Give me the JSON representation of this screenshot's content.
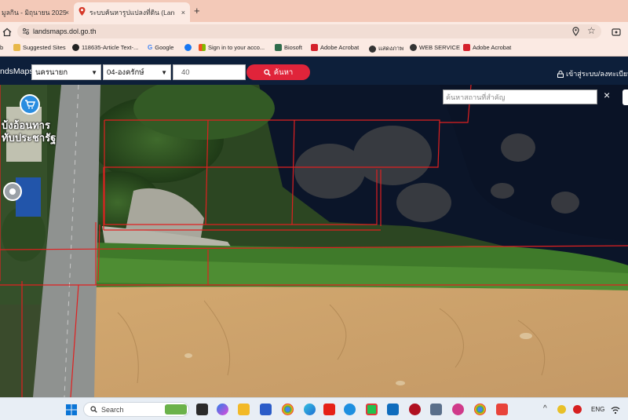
{
  "browser": {
    "tabs": [
      {
        "label": "มูลกิน - มิถุนายน 2025"
      },
      {
        "label": "ระบบค้นหารูปแปลงที่ดิน (LandsMap"
      }
    ],
    "new_tab_label": "+",
    "close_label": "×",
    "url": "landsmaps.dol.go.th"
  },
  "bookmarks": [
    {
      "label": "Suggested Sites",
      "icon": "folder-icon"
    },
    {
      "label": "118635-Article Text-...",
      "icon": "github-icon"
    },
    {
      "label": "Google",
      "icon": "google-icon"
    },
    {
      "label": "Sign in to your acco...",
      "icon": "microsoft-icon"
    },
    {
      "label": "Biosoft",
      "icon": "biosoft-icon"
    },
    {
      "label": "Adobe Acrobat",
      "icon": "acrobat-icon"
    },
    {
      "label": "แสดงภาพ",
      "icon": "globe-icon"
    },
    {
      "label": "WEB SERVICE",
      "icon": "globe-icon"
    },
    {
      "label": "Adobe Acrobat",
      "icon": "acrobat-icon"
    }
  ],
  "app": {
    "brand": "ndsMaps",
    "province": "นครนายก",
    "district": "04-องครักษ์",
    "parcel_number": "40",
    "search_button": "ค้นหา",
    "login_link": "เข้าสู่ระบบ/ลงทะเบียน",
    "place_search_placeholder": "ค้นหาสถานที่สำคัญ",
    "place_search_close": "×",
    "map_label_line1": "บ้งอ้อนทาร",
    "map_label_line2": "ทับประชารัฐ"
  },
  "taskbar": {
    "search_placeholder": "Search",
    "language": "ENG"
  },
  "colors": {
    "tab_bar": "#f3c9b8",
    "app_header": "#0d1f3a",
    "search_button": "#e0243a",
    "parcel_lines": "#e02020",
    "field": "#caa06a",
    "water": "#0a1428"
  }
}
